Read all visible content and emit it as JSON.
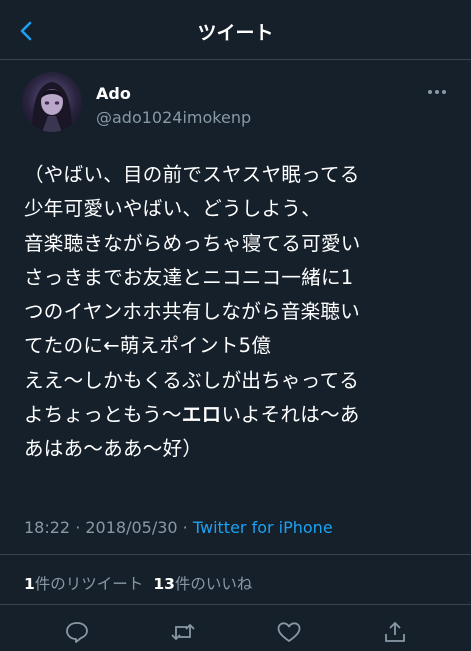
{
  "header": {
    "title": "ツイート"
  },
  "user": {
    "display_name": "Ado",
    "username": "@ado1024imokenp"
  },
  "tweet": {
    "lines": [
      "（やばい、目の前でスヤスヤ眠ってる",
      "少年可愛いやばい、どうしよう、",
      "音楽聴きながらめっちゃ寝てる可愛い",
      "さっきまでお友達とニコニコ一緒に1",
      "つのイヤンホホ共有しながら音楽聴い",
      "てたのに←萌えポイント5億",
      "ええ〜しかもくるぶしが出ちゃってる",
      "よちょっともう〜",
      "エロ",
      "いよそれは〜あ",
      "あはあ〜ああ〜好）"
    ],
    "time": "18:22",
    "separator": " · ",
    "date": "2018/05/30",
    "source": "Twitter for iPhone"
  },
  "stats": {
    "retweets_count": "1",
    "retweets_label": "件のリツイート",
    "likes_count": "13",
    "likes_label": "件のいいね"
  },
  "actions": [
    "reply-icon",
    "retweet-icon",
    "like-icon",
    "share-icon"
  ],
  "colors": {
    "background": "#15202b",
    "accent": "#1da1f2",
    "secondary": "#8899a6",
    "divider": "#38444d"
  }
}
